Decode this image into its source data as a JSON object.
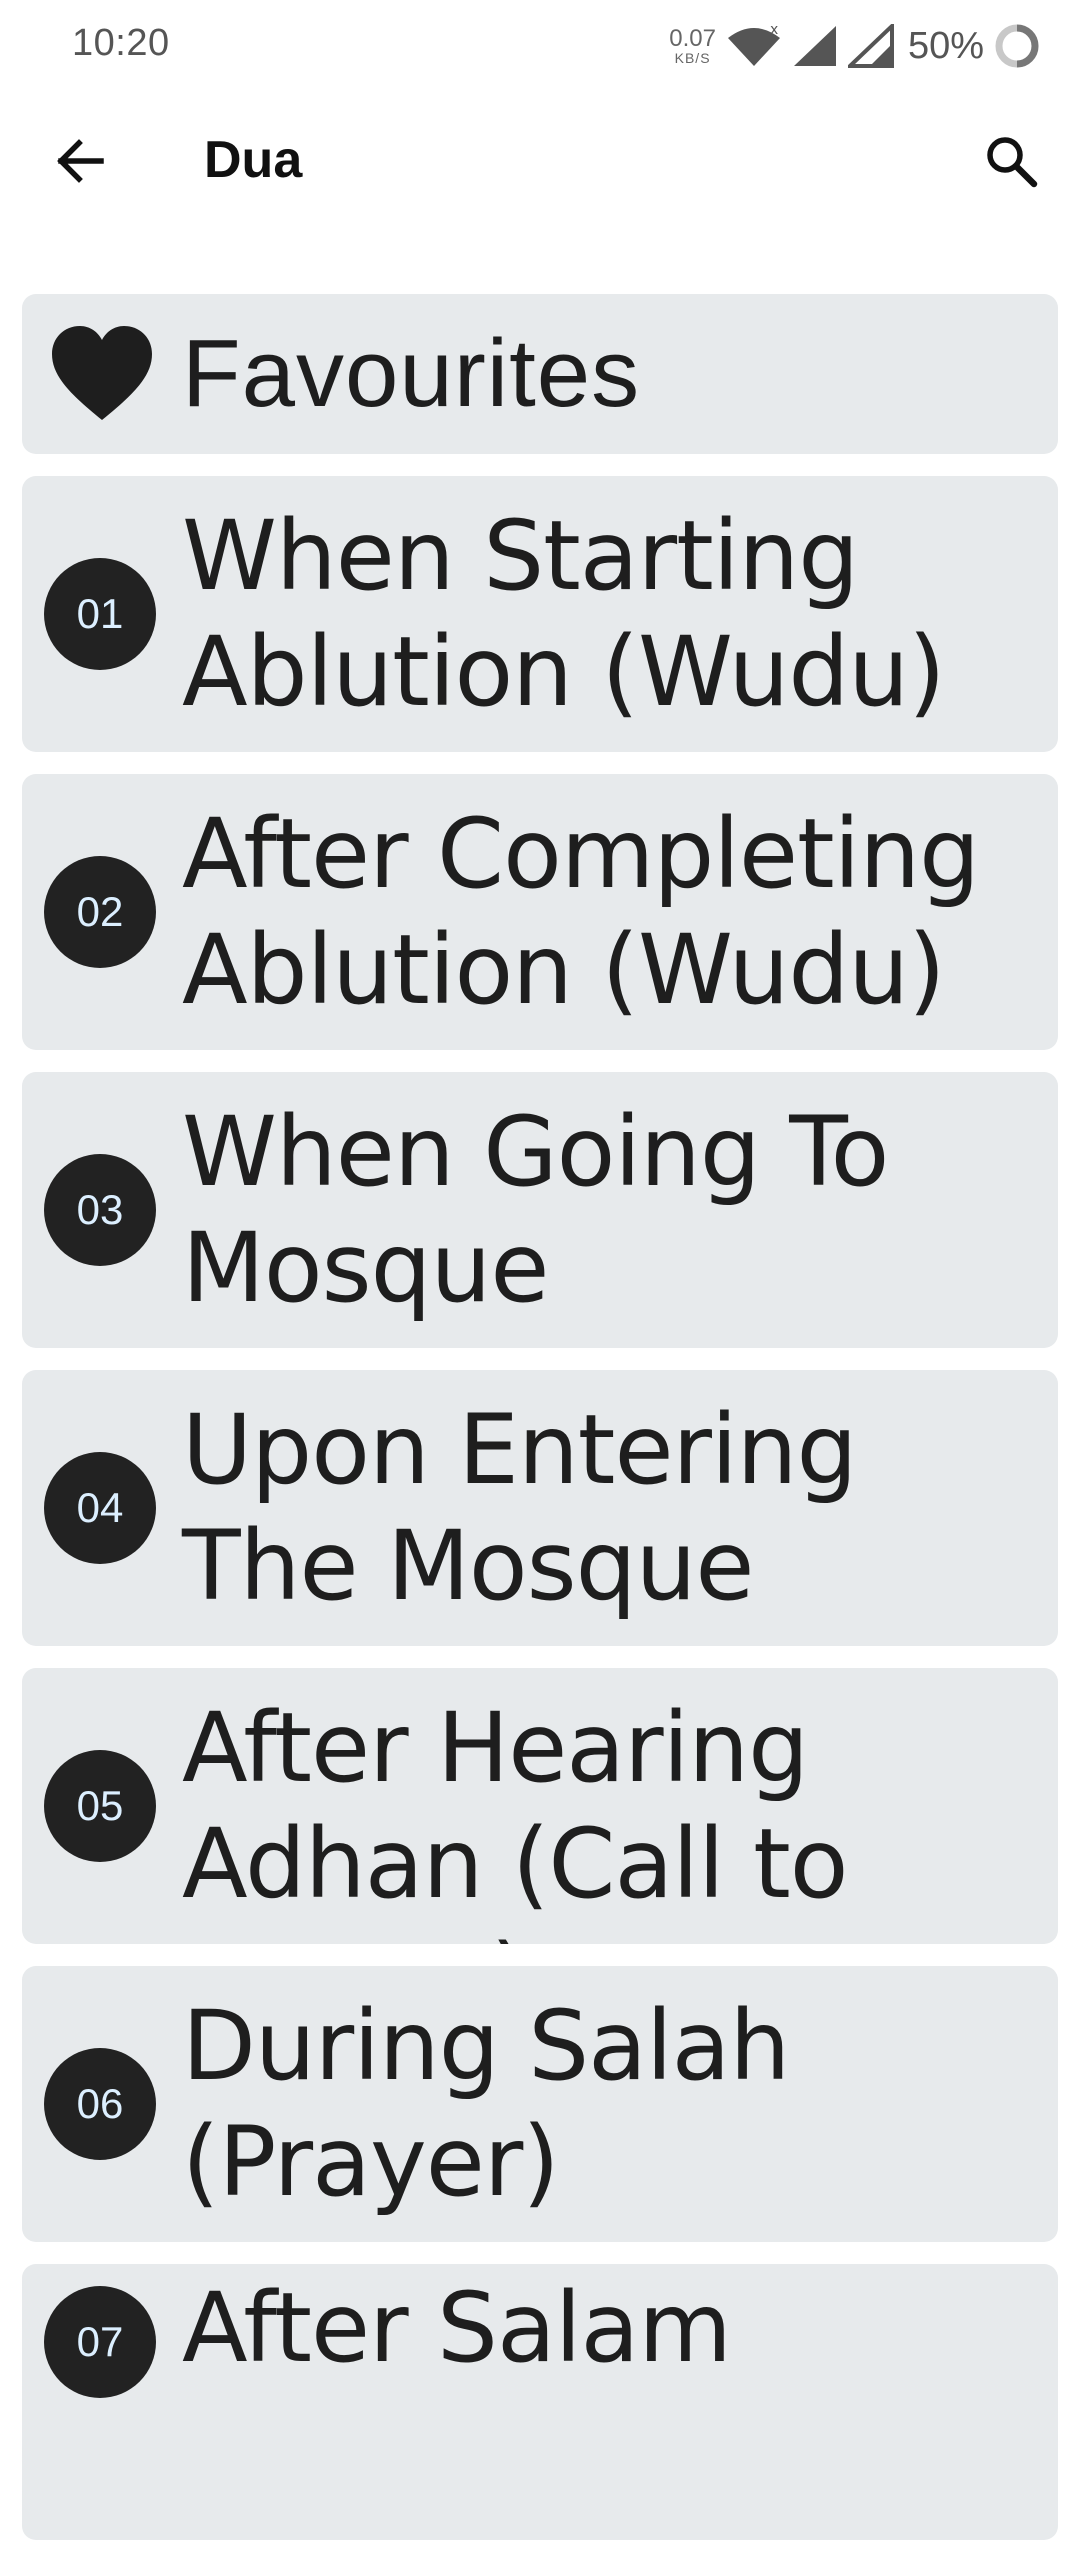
{
  "status": {
    "time": "10:20",
    "net_speed_value": "0.07",
    "net_speed_unit": "KB/S",
    "battery": "50%",
    "icons": [
      "wifi-icon",
      "signal-icon",
      "signal-icon",
      "battery-icon"
    ]
  },
  "app_bar": {
    "title": "Dua",
    "back_icon": "arrow-left-icon",
    "search_icon": "search-icon"
  },
  "favourites": {
    "label": "Favourites",
    "icon": "heart-icon"
  },
  "items": [
    {
      "number": "01",
      "title": "When Starting Ablution (Wudu)"
    },
    {
      "number": "02",
      "title": "After Completing Ablution (Wudu)"
    },
    {
      "number": "03",
      "title": "When Going To Mosque"
    },
    {
      "number": "04",
      "title": "Upon Entering The Mosque"
    },
    {
      "number": "05",
      "title": "After Hearing Adhan (Call to prayer)"
    },
    {
      "number": "06",
      "title": "During Salah (Prayer)"
    },
    {
      "number": "07",
      "title": "After Salam"
    }
  ],
  "colors": {
    "card_bg": "#e7eaec",
    "badge_bg": "#222222",
    "badge_text": "#dcefff"
  }
}
